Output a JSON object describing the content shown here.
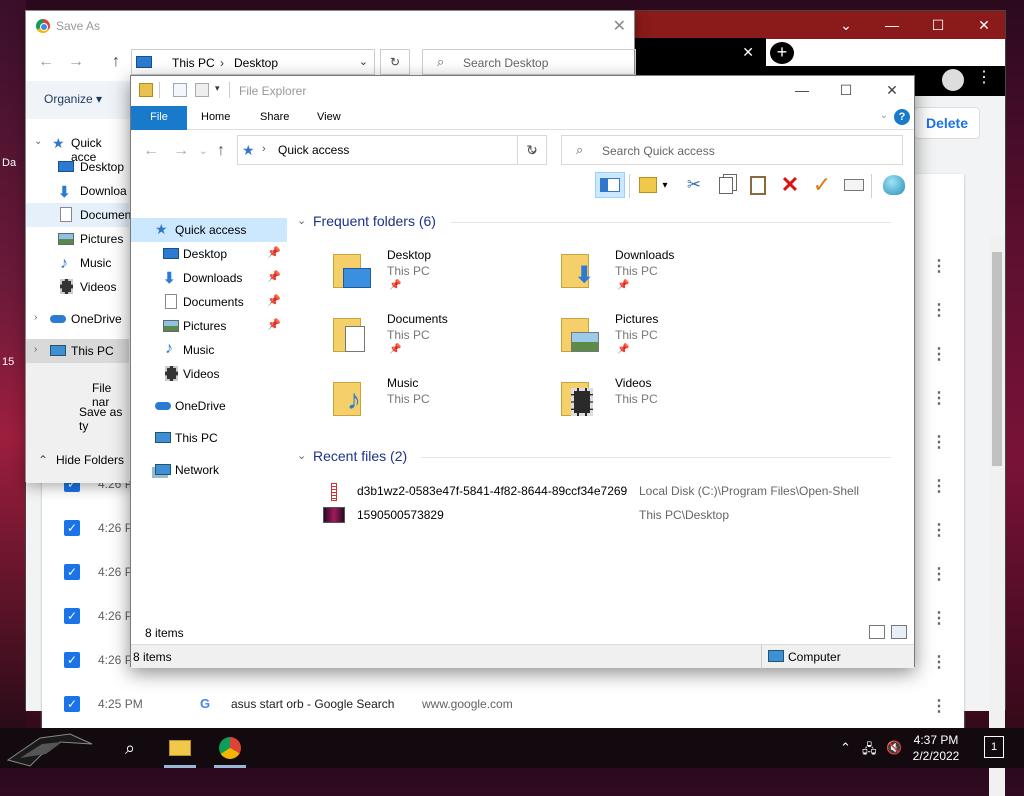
{
  "wallpaper": {
    "left_texts": [
      "Da",
      "15"
    ]
  },
  "chrome": {
    "new_tab": "+",
    "tab_close": "✕",
    "caption": {
      "minimize": "—",
      "maximize": "☐",
      "close": "✕"
    },
    "delete_button": "Delete",
    "history_rows": [
      {
        "time": "4:26 P",
        "title": "",
        "url": ""
      },
      {
        "time": "4:26 P",
        "title": "",
        "url": ""
      },
      {
        "time": "4:26 P",
        "title": "",
        "url": ""
      },
      {
        "time": "4:26 P",
        "title": "",
        "url": ""
      },
      {
        "time": "4:26 P",
        "title": "",
        "url": ""
      },
      {
        "time": "4:25 PM",
        "title": "asus start orb - Google Search",
        "url": "www.google.com"
      }
    ]
  },
  "save_as": {
    "title": "Save As",
    "close": "✕",
    "path": {
      "root": "This PC",
      "current": "Desktop"
    },
    "search_placeholder": "Search Desktop",
    "organize": "Organize ▾",
    "tree": [
      {
        "label": "Quick acce",
        "icon": "star-icon"
      },
      {
        "label": "Desktop",
        "icon": "desktop-icon"
      },
      {
        "label": "Downloa",
        "icon": "download-icon"
      },
      {
        "label": "Documen",
        "icon": "document-icon"
      },
      {
        "label": "Pictures",
        "icon": "pictures-icon"
      },
      {
        "label": "Music",
        "icon": "music-icon"
      },
      {
        "label": "Videos",
        "icon": "videos-icon"
      },
      {
        "label": "OneDrive",
        "icon": "cloud-icon"
      },
      {
        "label": "This PC",
        "icon": "computer-icon"
      }
    ],
    "file_name_label": "File nar",
    "save_as_type_label": "Save as ty",
    "hide_folders": "Hide Folders"
  },
  "explorer": {
    "title": "File Explorer",
    "ribbon_tabs": [
      "File",
      "Home",
      "Share",
      "View"
    ],
    "help": "?",
    "caption": {
      "minimize": "—",
      "maximize": "☐",
      "close": "✕"
    },
    "address": "Quick access",
    "search_placeholder": "Search Quick access",
    "nav_pane": [
      {
        "label": "Quick access",
        "icon": "star-icon",
        "pinned": false
      },
      {
        "label": "Desktop",
        "icon": "desktop-icon",
        "pinned": true
      },
      {
        "label": "Downloads",
        "icon": "download-icon",
        "pinned": true
      },
      {
        "label": "Documents",
        "icon": "document-icon",
        "pinned": true
      },
      {
        "label": "Pictures",
        "icon": "pictures-icon",
        "pinned": true
      },
      {
        "label": "Music",
        "icon": "music-icon",
        "pinned": false
      },
      {
        "label": "Videos",
        "icon": "videos-icon",
        "pinned": false
      },
      {
        "label": "OneDrive",
        "icon": "cloud-icon",
        "pinned": false
      },
      {
        "label": "This PC",
        "icon": "computer-icon",
        "pinned": false
      },
      {
        "label": "Network",
        "icon": "network-icon",
        "pinned": false
      }
    ],
    "frequent_header": "Frequent folders (6)",
    "frequent": [
      {
        "name": "Desktop",
        "location": "This PC",
        "pinned": true,
        "overlay": "desktop"
      },
      {
        "name": "Downloads",
        "location": "This PC",
        "pinned": true,
        "overlay": "download"
      },
      {
        "name": "Documents",
        "location": "This PC",
        "pinned": true,
        "overlay": "document"
      },
      {
        "name": "Pictures",
        "location": "This PC",
        "pinned": true,
        "overlay": "pictures"
      },
      {
        "name": "Music",
        "location": "This PC",
        "pinned": false,
        "overlay": "music"
      },
      {
        "name": "Videos",
        "location": "This PC",
        "pinned": false,
        "overlay": "videos"
      }
    ],
    "recent_header": "Recent files (2)",
    "recent": [
      {
        "name": "d3b1wz2-0583e47f-5841-4f82-8644-89ccf34e7269",
        "location": "Local Disk (C:)\\Program Files\\Open-Shell",
        "icon": "text-file-icon"
      },
      {
        "name": "1590500573829",
        "location": "This PC\\Desktop",
        "icon": "image-file-icon"
      }
    ],
    "status_count": "8 items",
    "bottom_count": "8 items",
    "bottom_location": "Computer"
  },
  "taskbar": {
    "clock_time": "4:37 PM",
    "clock_date": "2/2/2022",
    "notifications": "1"
  }
}
